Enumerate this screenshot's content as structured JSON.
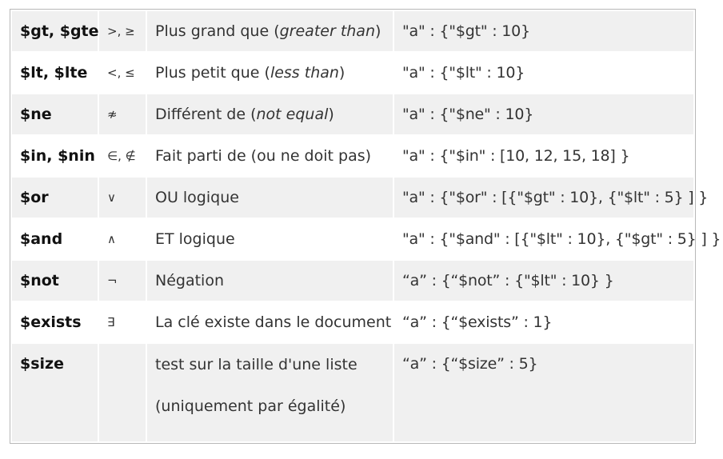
{
  "rows": [
    {
      "operator": "$gt, $gte",
      "symbol": ">, ≥",
      "desc_prefix": "Plus grand que (",
      "desc_italic": "greater than",
      "desc_suffix": ")",
      "example": "\"a\" : {\"$gt\" : 10}"
    },
    {
      "operator": "$lt, $lte",
      "symbol": "<, ≤",
      "desc_prefix": "Plus petit que (",
      "desc_italic": "less than",
      "desc_suffix": ")",
      "example": "\"a\" : {\"$lt\" : 10}"
    },
    {
      "operator": "$ne",
      "symbol": "≉",
      "desc_prefix": "Différent de (",
      "desc_italic": "not equal",
      "desc_suffix": ")",
      "example": "\"a\" : {\"$ne\" : 10}"
    },
    {
      "operator": "$in, $nin",
      "symbol": "∈, ∉",
      "desc": "Fait parti de (ou ne doit pas)",
      "example": "\"a\" : {\"$in\" : [10, 12, 15, 18] }"
    },
    {
      "operator": "$or",
      "symbol": "∨",
      "desc": "OU logique",
      "example": "\"a\" : {\"$or\" : [{\"$gt\" : 10}, {\"$lt\" : 5} ] }"
    },
    {
      "operator": "$and",
      "symbol": "∧",
      "desc": "ET logique",
      "example": "\"a\" : {\"$and\" : [{\"$lt\" : 10}, {\"$gt\" : 5} ] }"
    },
    {
      "operator": "$not",
      "symbol": "¬",
      "desc": "Négation",
      "example": "“a” : {“$not” : {\"$lt\" : 10} }"
    },
    {
      "operator": "$exists",
      "symbol": "∃",
      "desc": "La clé existe dans le document",
      "example": "“a” : {“$exists” : 1}"
    },
    {
      "operator": "$size",
      "symbol": "",
      "desc_line1": "test sur la taille d'une liste",
      "desc_line2": "(uniquement par égalité)",
      "example": "“a” : {“$size” : 5}"
    }
  ]
}
